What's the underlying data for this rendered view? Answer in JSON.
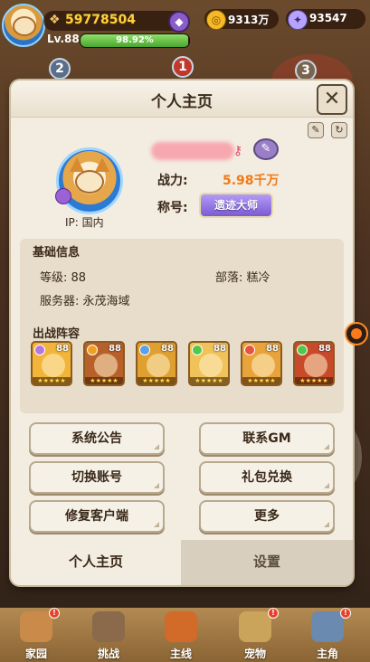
{
  "hud": {
    "score": "59778504",
    "level": "Lv.88",
    "exp_percent": "98.92%",
    "exp_fraction": 0.9892,
    "gold": "9313万",
    "gems": "93547",
    "stage_badges": [
      "2",
      "1",
      "3"
    ]
  },
  "modal": {
    "title": "个人主页",
    "close_icon": "close-icon",
    "ip_label": "IP: 国内",
    "power_label": "战力:",
    "power_value": "5.98千万",
    "title_label": "称号:",
    "title_badge": "遗迹大师",
    "basic_info_title": "基础信息",
    "level_label": "等级: 88",
    "tribe_label": "部落: 糕冷",
    "server_label": "服务器: 永茂海域",
    "lineup_title": "出战阵容",
    "lineup": [
      {
        "level": "88",
        "color": "#f2b53a",
        "element": "#b078e0"
      },
      {
        "level": "88",
        "color": "#b8602a",
        "element": "#f0a020"
      },
      {
        "level": "88",
        "color": "#e0a030",
        "element": "#5aa0e8"
      },
      {
        "level": "88",
        "color": "#f0c35a",
        "element": "#52c84a"
      },
      {
        "level": "88",
        "color": "#e8a43a",
        "element": "#e85040"
      },
      {
        "level": "88",
        "color": "#c84a2a",
        "element": "#52c84a"
      }
    ],
    "buttons": {
      "announcement": "系统公告",
      "contact_gm": "联系GM",
      "switch_account": "切换账号",
      "gift_redeem": "礼包兑换",
      "repair_client": "修复客户端",
      "more": "更多"
    },
    "tabs": {
      "profile": "个人主页",
      "settings": "设置"
    }
  },
  "nav": {
    "items": [
      "家园",
      "挑战",
      "主线",
      "宠物",
      "主角"
    ],
    "badge": "!"
  },
  "colors": {
    "accent_orange": "#f07a1a",
    "title_purple": "#7a5ad4",
    "panel_bg": "#f3ece0"
  }
}
